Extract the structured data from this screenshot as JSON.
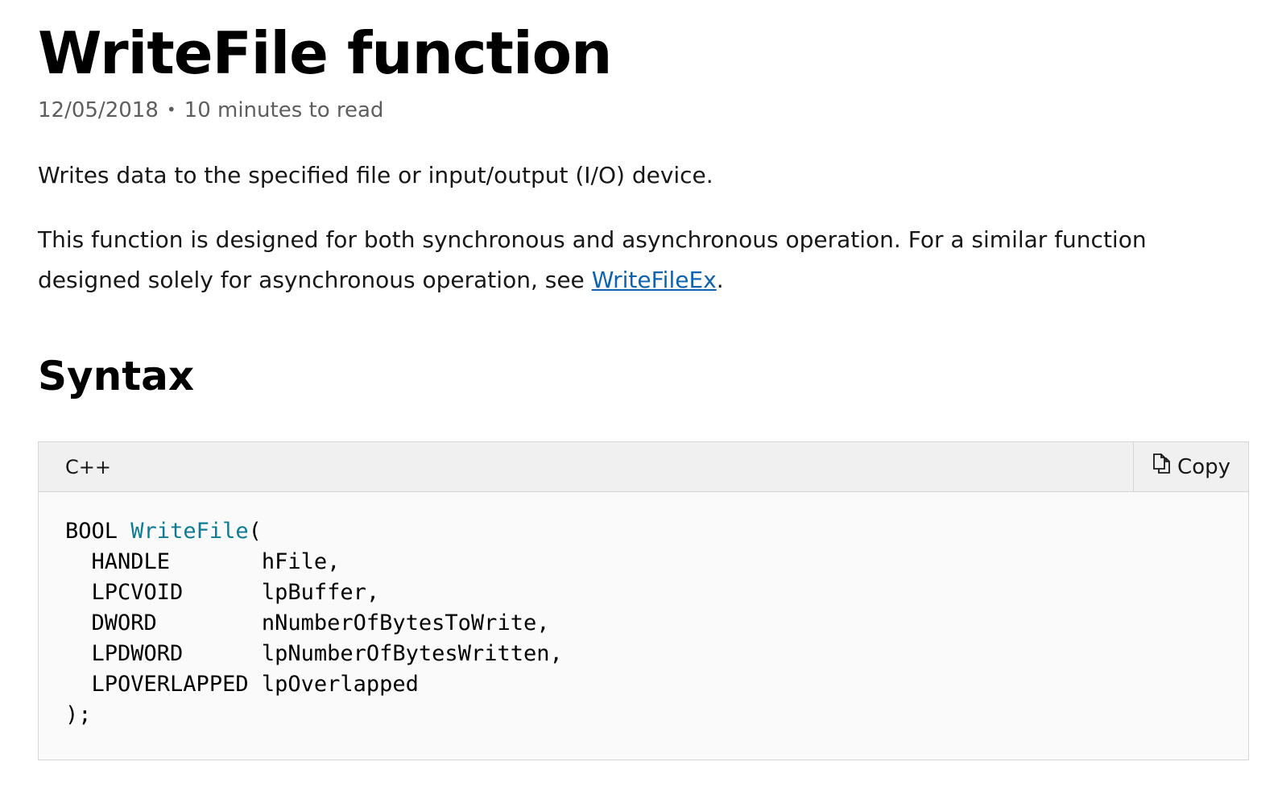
{
  "title": "WriteFile function",
  "meta": {
    "date": "12/05/2018",
    "separator": "•",
    "read_time": "10 minutes to read"
  },
  "description": "Writes data to the specified file or input/output (I/O) device.",
  "paragraph2": {
    "text_before": "This function is designed for both synchronous and asynchronous operation. For a similar function designed solely for asynchronous operation, see ",
    "link_text": "WriteFileEx",
    "text_after": "."
  },
  "syntax_heading": "Syntax",
  "code": {
    "language": "C++",
    "copy_label": "Copy",
    "return_type": "BOOL",
    "function_name": "WriteFile",
    "open_paren": "(",
    "params": [
      {
        "type": "HANDLE",
        "name": "hFile,"
      },
      {
        "type": "LPCVOID",
        "name": "lpBuffer,"
      },
      {
        "type": "DWORD",
        "name": "nNumberOfBytesToWrite,"
      },
      {
        "type": "LPDWORD",
        "name": "lpNumberOfBytesWritten,"
      },
      {
        "type": "LPOVERLAPPED",
        "name": "lpOverlapped"
      }
    ],
    "close": ");"
  },
  "colors": {
    "link": "#0f62ad",
    "function_name": "#0e7b92",
    "code_background": "#fafafa",
    "code_header_background": "#f0f0f0"
  }
}
